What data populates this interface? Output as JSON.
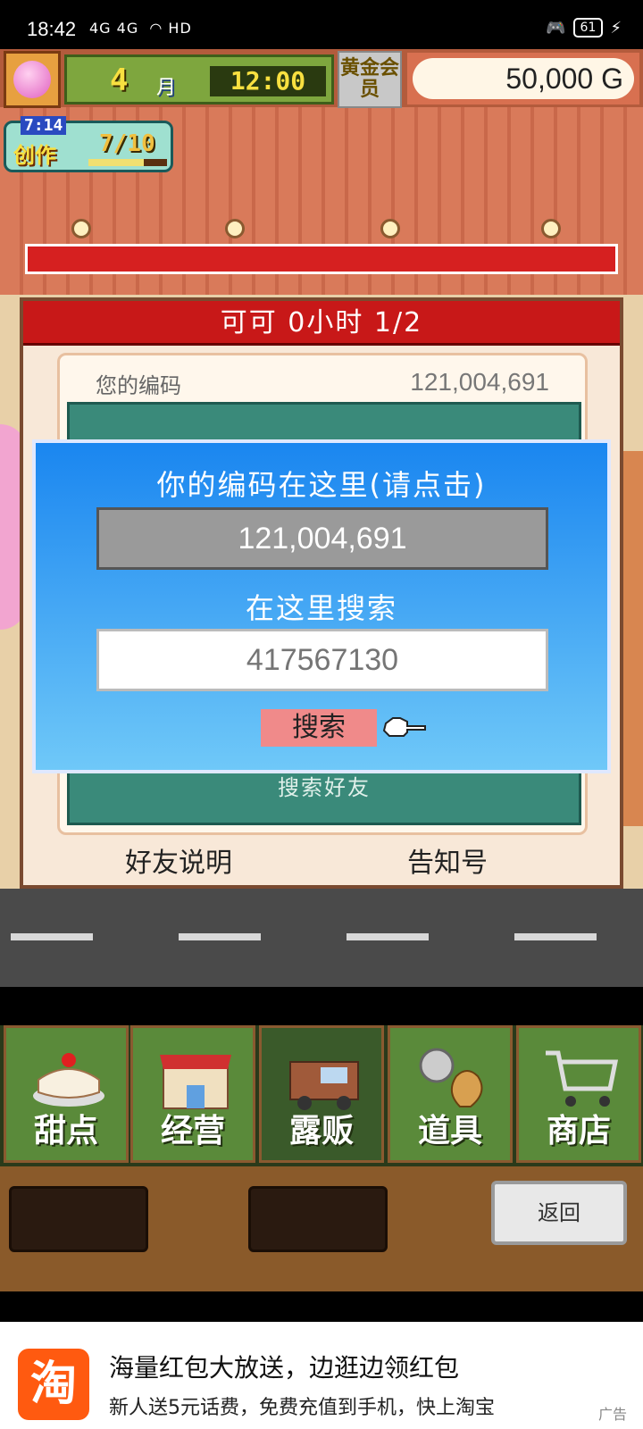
{
  "status_bar": {
    "time": "18:42",
    "network": "4G 4G",
    "network_extra": "HD",
    "battery": "61"
  },
  "hud": {
    "month_number": "4",
    "month_label": "月",
    "clock": "12:00",
    "member_label": "黄金会员",
    "gold": "50,000 G",
    "create_timer": "7:14",
    "create_label": "创作",
    "create_count": "7/10",
    "create_progress": 0.7
  },
  "friend_panel": {
    "header": "可可  0小时 1/2",
    "code_label": "您的编码",
    "code_value": "121,004,691",
    "search_friend_label": "搜索好友",
    "footer_left": "好友说明",
    "footer_right": "告知号"
  },
  "dialog": {
    "title": "你的编码在这里(请点击)",
    "code_value": "121,004,691",
    "search_title": "在这里搜索",
    "search_placeholder": "417567130",
    "search_button": "搜索"
  },
  "menu": [
    {
      "label": "甜点",
      "icon": "cake-icon"
    },
    {
      "label": "经营",
      "icon": "shop-icon"
    },
    {
      "label": "露贩",
      "icon": "food-truck-icon"
    },
    {
      "label": "道具",
      "icon": "items-icon"
    },
    {
      "label": "商店",
      "icon": "cart-icon"
    }
  ],
  "tray": {
    "back_button": "返回"
  },
  "ad": {
    "logo": "淘",
    "line1": "海量红包大放送，边逛边领红包",
    "line2": "新人送5元话费，免费充值到手机，快上淘宝",
    "tag": "广告"
  },
  "colors": {
    "dialog_top": "#1a86f0",
    "dialog_bottom": "#6fc8f8",
    "header_red": "#c81818",
    "search_button": "#f08a8a"
  }
}
